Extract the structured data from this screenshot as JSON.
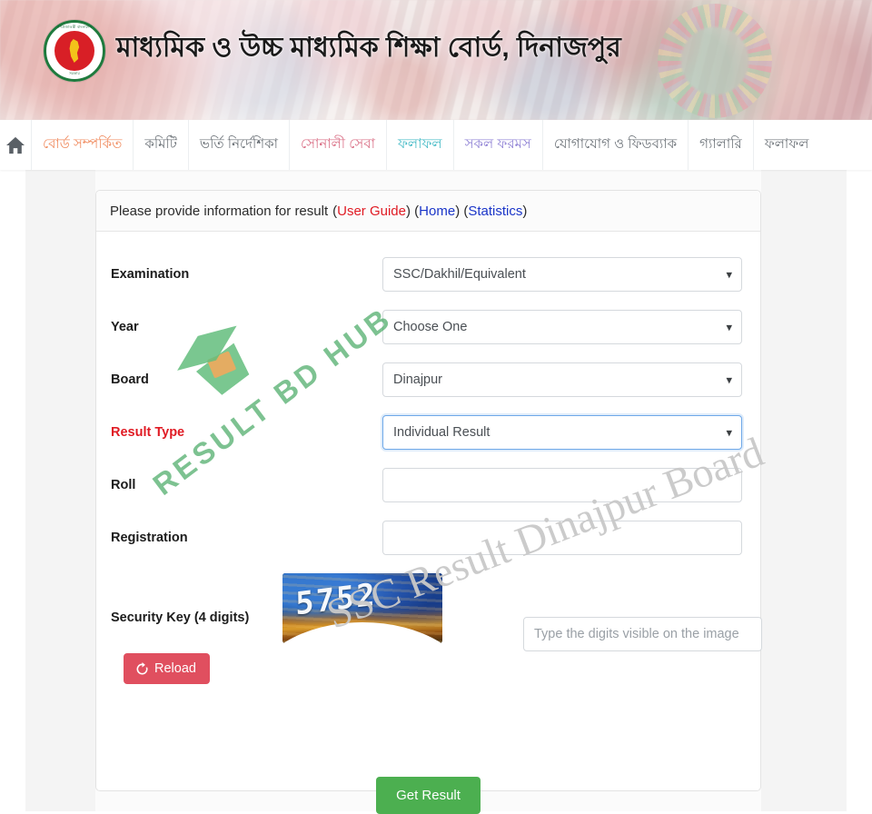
{
  "banner": {
    "title": "মাধ্যমিক ও উচ্চ মাধ্যমিক শিক্ষা বোর্ড, দিনাজপুর",
    "logo_top_text": "গণপ্রজাতন্ত্রী বাংলাদেশ",
    "logo_bottom_text": "সরকার",
    "logo_icon": "bangladesh-government-emblem"
  },
  "nav": {
    "home_icon": "home-icon",
    "items": [
      {
        "label": "বোর্ড সম্পর্কিত",
        "color": "orange"
      },
      {
        "label": "কমিটি",
        "color": "gray"
      },
      {
        "label": "ভর্তি নির্দেশিকা",
        "color": "gray"
      },
      {
        "label": "সোনালী সেবা",
        "color": "pinkish"
      },
      {
        "label": "ফলাফল",
        "color": "teal"
      },
      {
        "label": "সকল ফরমস",
        "color": "violet"
      },
      {
        "label": "যোগাযোগ ও ফিডব্যাক",
        "color": "gray"
      },
      {
        "label": "গ্যালারি",
        "color": "gray"
      },
      {
        "label": "ফলাফল",
        "color": "gray"
      }
    ]
  },
  "panel": {
    "header": {
      "text": "Please provide information for result",
      "open_paren": "(",
      "user_guide": "User Guide",
      "close_paren_1": ") (",
      "home": "Home",
      "close_paren_2": ") (",
      "statistics": "Statistics",
      "close_paren_3": ")"
    },
    "fields": {
      "examination": {
        "label": "Examination",
        "value": "SSC/Dakhil/Equivalent"
      },
      "year": {
        "label": "Year",
        "value": "Choose One"
      },
      "board": {
        "label": "Board",
        "value": "Dinajpur"
      },
      "result_type": {
        "label": "Result Type",
        "value": "Individual Result",
        "required": true
      },
      "roll": {
        "label": "Roll",
        "value": "",
        "placeholder": ""
      },
      "registration": {
        "label": "Registration",
        "value": "",
        "placeholder": ""
      },
      "security_key": {
        "label": "Security Key (4 digits)",
        "captcha_digits": "5752",
        "captcha_icon": "captcha-image",
        "placeholder": "Type the digits visible on the image",
        "value": ""
      }
    },
    "reload_button": {
      "label": "Reload",
      "icon": "refresh-icon"
    },
    "submit_button": {
      "label": "Get Result"
    }
  },
  "watermarks": {
    "hub": {
      "text": "RESULT BD HUB",
      "icon": "graduation-cap-icon"
    },
    "ssc": {
      "text": "SSC Result Dinajpur Board"
    }
  },
  "colors": {
    "submit_green": "#4caf50",
    "reload_red": "#e04f5f",
    "link_red": "#e01b24",
    "link_blue": "#1a35c8",
    "required_red": "#e01b24",
    "focus_blue": "#6ea8e8",
    "watermark_green": "#2e9e4f"
  }
}
